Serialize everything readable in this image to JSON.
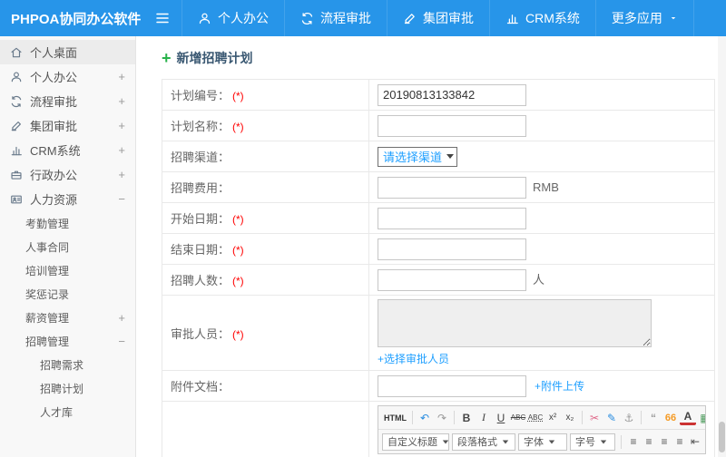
{
  "colors": {
    "topbar_blue": "#2795E9",
    "link_blue": "#1E9FFF",
    "required_red": "#FF0000",
    "plus_green": "#27B24A",
    "title_navy": "#3A5872"
  },
  "topbar": {
    "logo": "PHPOA协同办公软件",
    "nav": [
      {
        "label": "个人办公",
        "icon": "person-icon"
      },
      {
        "label": "流程审批",
        "icon": "flow-approval-icon"
      },
      {
        "label": "集团审批",
        "icon": "edit-approval-icon"
      },
      {
        "label": "CRM系统",
        "icon": "chart-icon"
      },
      {
        "label": "更多应用",
        "icon": "caret-down-icon"
      }
    ]
  },
  "sidebar": {
    "items": [
      {
        "label": "个人桌面",
        "icon": "home-icon",
        "expand": "",
        "level": 1
      },
      {
        "label": "个人办公",
        "icon": "person-icon",
        "expand": "+",
        "level": 1
      },
      {
        "label": "流程审批",
        "icon": "flow-approval-icon",
        "expand": "+",
        "level": 1
      },
      {
        "label": "集团审批",
        "icon": "edit-approval-icon",
        "expand": "+",
        "level": 1
      },
      {
        "label": "CRM系统",
        "icon": "chart-icon",
        "expand": "+",
        "level": 1
      },
      {
        "label": "行政办公",
        "icon": "briefcase-icon",
        "expand": "+",
        "level": 1
      },
      {
        "label": "人力资源",
        "icon": "id-card-icon",
        "expand": "−",
        "level": 1
      },
      {
        "label": "考勤管理",
        "expand": "",
        "level": 2
      },
      {
        "label": "人事合同",
        "expand": "",
        "level": 2
      },
      {
        "label": "培训管理",
        "expand": "",
        "level": 2
      },
      {
        "label": "奖惩记录",
        "expand": "",
        "level": 2
      },
      {
        "label": "薪资管理",
        "expand": "+",
        "level": 2
      },
      {
        "label": "招聘管理",
        "expand": "−",
        "level": 2
      },
      {
        "label": "招聘需求",
        "expand": "",
        "level": 3
      },
      {
        "label": "招聘计划",
        "expand": "",
        "level": 3
      },
      {
        "label": "人才库",
        "expand": "",
        "level": 3
      }
    ]
  },
  "page": {
    "title_icon": "+",
    "title": "新增招聘计划"
  },
  "form": {
    "rows": [
      {
        "label": "计划编号：",
        "required": "(*)",
        "value": "20190813133842"
      },
      {
        "label": "计划名称：",
        "required": "(*)",
        "value": ""
      },
      {
        "label": "招聘渠道：",
        "required": "",
        "select_value": "请选择渠道"
      },
      {
        "label": "招聘费用：",
        "required": "",
        "value": "",
        "suffix": "RMB"
      },
      {
        "label": "开始日期：",
        "required": "(*)",
        "value": ""
      },
      {
        "label": "结束日期：",
        "required": "(*)",
        "value": ""
      },
      {
        "label": "招聘人数：",
        "required": "(*)",
        "value": "",
        "suffix": "人"
      },
      {
        "label": "审批人员：",
        "required": "(*)",
        "textarea_value": "",
        "link": "+选择审批人员"
      },
      {
        "label": "附件文档：",
        "required": "",
        "value": "",
        "link": "+附件上传"
      }
    ]
  },
  "editor": {
    "toolbar_icons": [
      "HTML",
      "↶",
      "↷",
      "B",
      "I",
      "U",
      "ABC",
      "ABC",
      "x²",
      "x₂",
      "✂",
      "✎",
      "⚓",
      "“",
      "66",
      "A",
      "▦",
      "Ω"
    ],
    "format_selects": [
      "自定义标题",
      "段落格式",
      "字体",
      "字号"
    ],
    "align_icons": [
      "≡",
      "≡",
      "≡",
      "≡",
      "⇤",
      "⇥",
      "—",
      "☺"
    ]
  }
}
